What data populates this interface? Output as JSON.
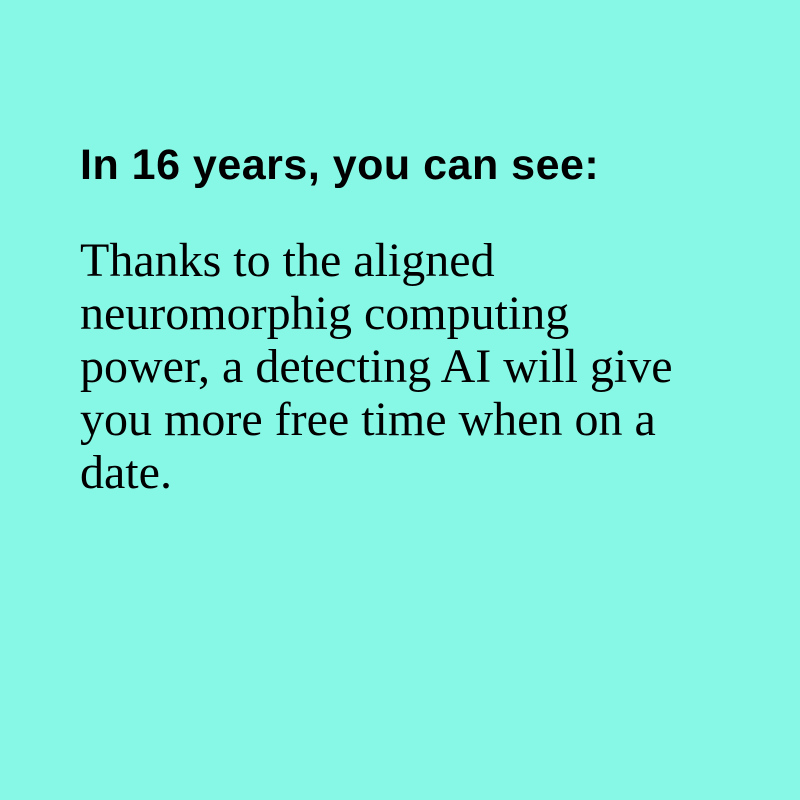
{
  "background_color": "#87f8e5",
  "text_color": "#000000",
  "headline": "In 16 years, you can see:",
  "body": "Thanks to the aligned neuromorphig computing power, a detecting AI will give you more free time when on a date."
}
